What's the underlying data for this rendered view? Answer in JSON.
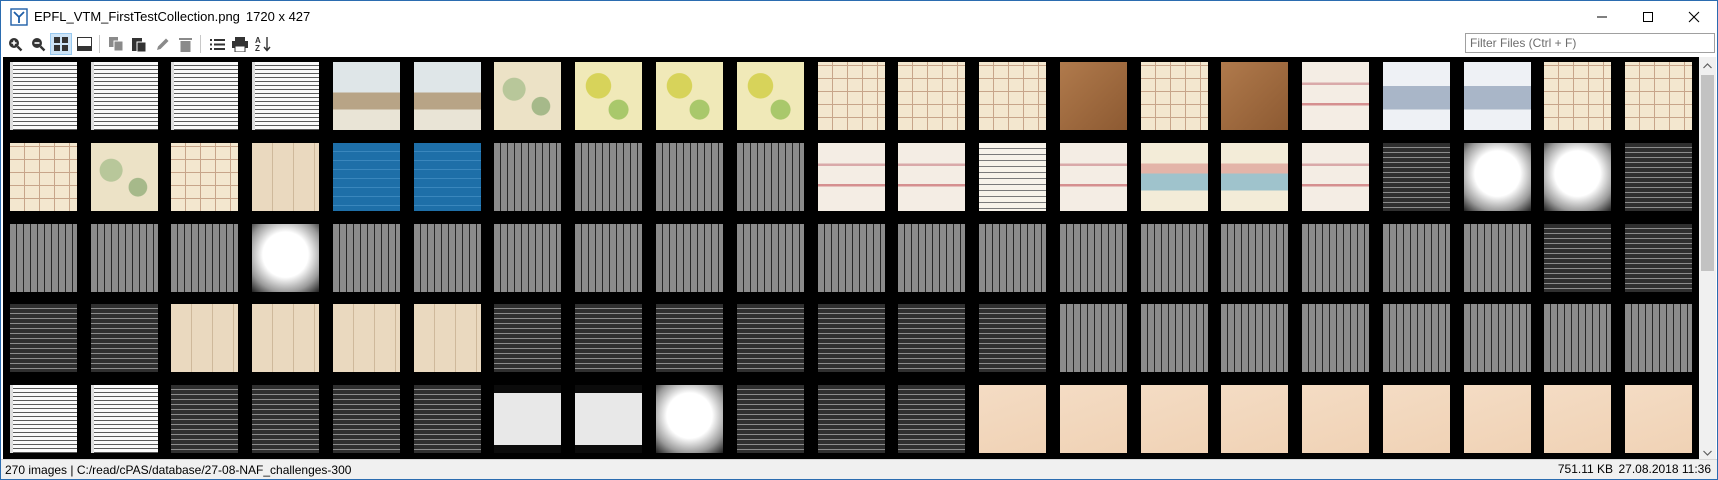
{
  "window": {
    "title": "EPFL_VTM_FirstTestCollection.png",
    "dimensions": "1720 x 427"
  },
  "toolbar": {
    "buttons": [
      {
        "name": "zoom-in-icon"
      },
      {
        "name": "zoom-out-icon"
      },
      {
        "name": "grid-view-icon",
        "active": true
      },
      {
        "name": "single-view-icon"
      },
      {
        "name": "copy-icon"
      },
      {
        "name": "paste-icon"
      },
      {
        "name": "edit-icon"
      },
      {
        "name": "delete-icon"
      },
      {
        "name": "list-view-icon"
      },
      {
        "name": "print-icon"
      },
      {
        "name": "sort-az-icon"
      }
    ],
    "filter_placeholder": "Filter Files (Ctrl + F)"
  },
  "grid": {
    "rows": [
      [
        "text",
        "text",
        "text",
        "text",
        "building",
        "building",
        "map",
        "map-yellow",
        "map-yellow",
        "map-yellow",
        "plan",
        "plan",
        "plan",
        "brown",
        "plan",
        "brown",
        "elevation",
        "elevation-blue",
        "elevation-blue",
        "plan",
        "plan"
      ],
      [
        "plan",
        "map",
        "plan",
        "paper",
        "blueprint",
        "blueprint",
        "gray-table",
        "gray-table",
        "gray-table",
        "gray-table",
        "elevation",
        "elevation",
        "letter",
        "elevation",
        "elevation-colored",
        "elevation-colored",
        "elevation",
        "dark-text",
        "bright-text",
        "bright-text",
        "dark-text"
      ],
      [
        "gray-table",
        "gray-table",
        "gray-table",
        "bright-text",
        "gray-table",
        "gray-table",
        "gray-table",
        "gray-table",
        "gray-table",
        "gray-table",
        "gray-table",
        "gray-table",
        "gray-table",
        "gray-table",
        "gray-table",
        "gray-table",
        "gray-table",
        "gray-table",
        "gray-table",
        "dark-text",
        "dark-text"
      ],
      [
        "dark-text",
        "dark-text",
        "paper",
        "paper",
        "paper",
        "paper",
        "dark-text",
        "dark-text",
        "dark-text",
        "dark-text",
        "dark-text",
        "dark-text",
        "dark-text",
        "gray-table",
        "gray-table",
        "gray-table",
        "gray-table",
        "gray-table",
        "gray-table",
        "gray-table",
        "gray-table"
      ],
      [
        "text",
        "text",
        "dark-text",
        "dark-text",
        "dark-text",
        "dark-text",
        "card",
        "card",
        "bright-text",
        "dark-text",
        "dark-text",
        "dark-text",
        "sketch",
        "sketch",
        "sketch",
        "sketch",
        "sketch",
        "sketch",
        "sketch",
        "sketch",
        "sketch"
      ]
    ]
  },
  "status": {
    "left": "270 images | C:/read/cPAS/database/27-08-NAF_challenges-300",
    "size": "751.11 KB",
    "date": "27.08.2018 11:36"
  },
  "colors": {
    "grid_bg": "#000000",
    "active_button_bg": "#cde4f7"
  }
}
